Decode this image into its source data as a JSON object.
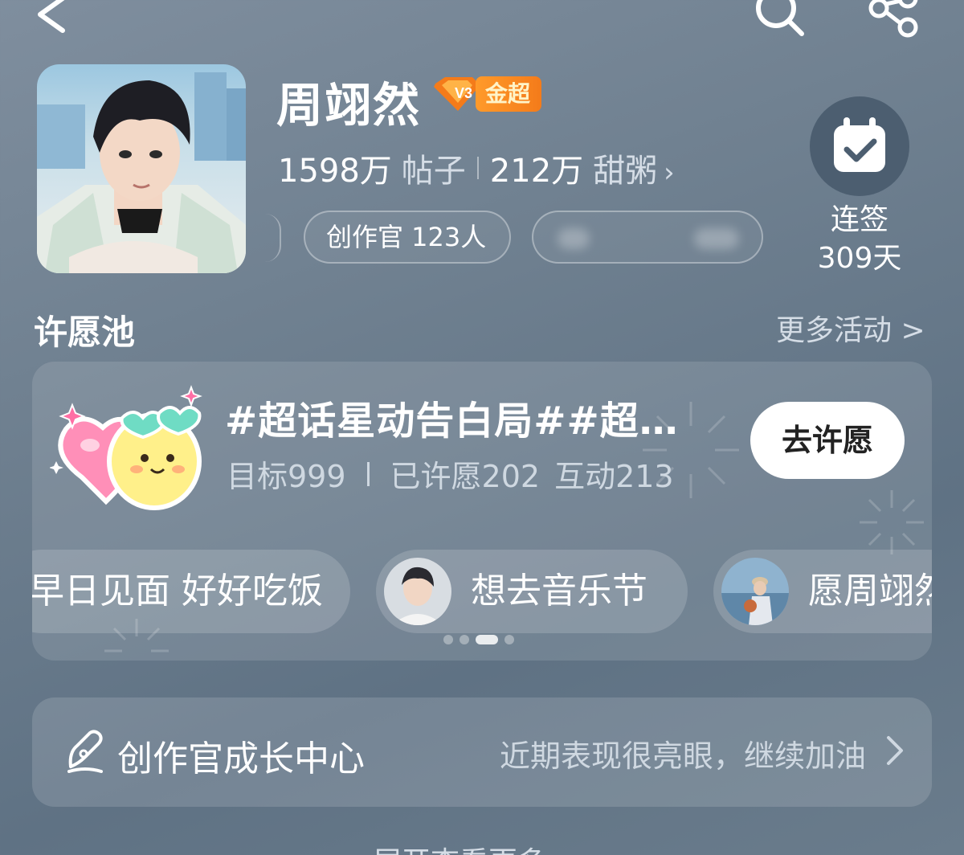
{
  "header": {
    "title": "周翊然",
    "badge_label": "金超",
    "posts_count": "1598万",
    "posts_label": "帖子",
    "fans_count": "212万",
    "fans_label": "甜粥",
    "creator_pill": "创作官 123人",
    "checkin_label": "连签",
    "checkin_days": "309天"
  },
  "wish_pool": {
    "section_title": "许愿池",
    "more_link": "更多活动 >",
    "topic": "#超话星动告白局##超话星动告白局#",
    "target": "目标999",
    "wished": "已许愿202",
    "interactions": "互动213",
    "wish_button": "去许愿",
    "chips": [
      {
        "label": "早日见面 好好吃饭"
      },
      {
        "label": "想去音乐节"
      },
      {
        "label": "愿周翊然"
      }
    ],
    "active_page": 3,
    "page_count": 4
  },
  "growth": {
    "title": "创作官成长中心",
    "note": "近期表现很亮眼，继续加油"
  },
  "footer": {
    "expand_label": "展开查看更多"
  },
  "colors": {
    "badge_orange": "#f47b1a",
    "checkin_bg": "#4c5e70"
  }
}
